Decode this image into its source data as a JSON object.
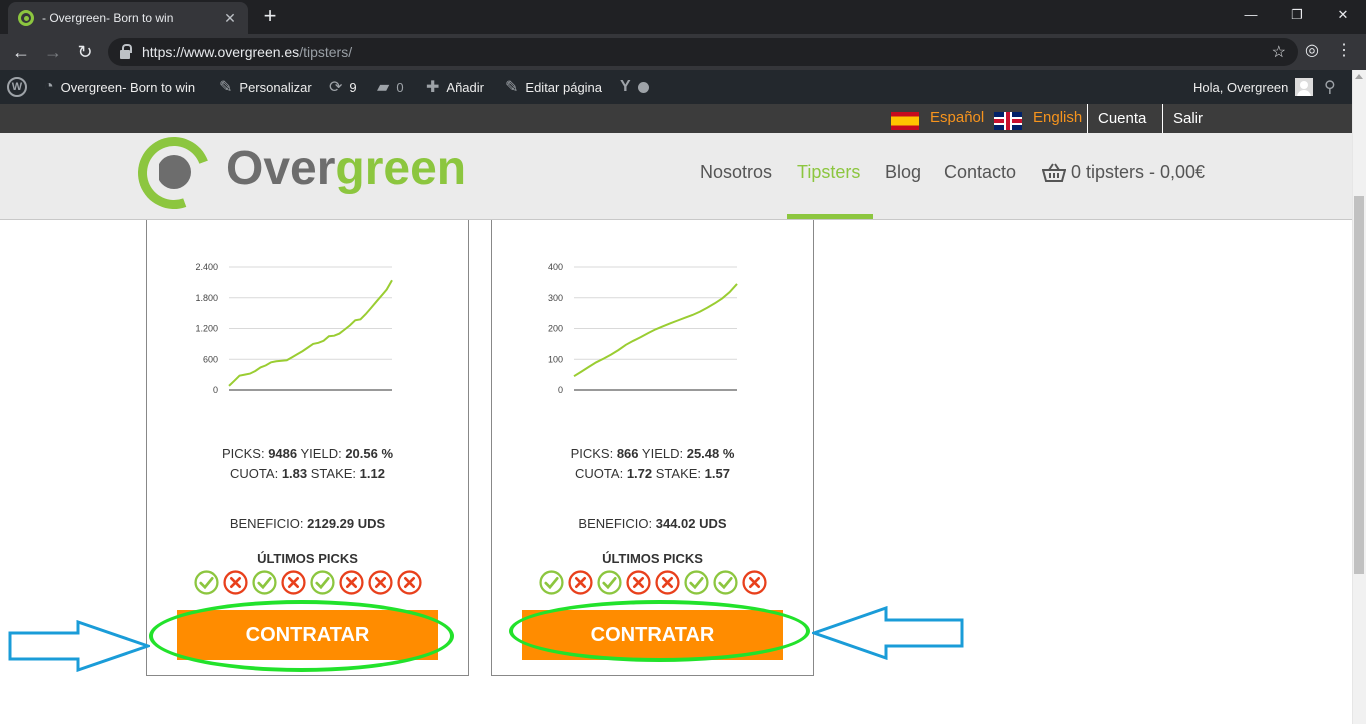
{
  "browser": {
    "tab_title": "- Overgreen- Born to win",
    "url_host": "https://www.overgreen.es",
    "url_path": "/tipsters/"
  },
  "adminbar": {
    "site_name": "Overgreen- Born to win",
    "customize": "Personalizar",
    "updates_count": "9",
    "comments_count": "0",
    "add_new": "Añadir",
    "edit_page": "Editar página",
    "greeting": "Hola, Overgreen"
  },
  "topbar": {
    "lang_es": "Español",
    "lang_en": "English",
    "account": "Cuenta",
    "logout": "Salir"
  },
  "header": {
    "logo_part1": "Over",
    "logo_part2": "green",
    "nav": [
      "Nosotros",
      "Tipsters",
      "Blog",
      "Contacto"
    ],
    "cart": "0 tipsters - 0,00€",
    "active_color": "#8cc63f"
  },
  "cards": [
    {
      "picks_label": "PICKS:",
      "picks": "9486",
      "yield_label": "YIELD:",
      "yield": "20.56 %",
      "cuota_label": "CUOTA:",
      "cuota": "1.83",
      "stake_label": "STAKE:",
      "stake": "1.12",
      "beneficio_label": "BENEFICIO:",
      "beneficio": "2129.29 UDS",
      "ultimos_label": "ÚLTIMOS PICKS",
      "last_picks": [
        "win",
        "loss",
        "win",
        "loss",
        "win",
        "loss",
        "loss",
        "loss"
      ],
      "button": "CONTRATAR"
    },
    {
      "picks_label": "PICKS:",
      "picks": "866",
      "yield_label": "YIELD:",
      "yield": "25.48 %",
      "cuota_label": "CUOTA:",
      "cuota": "1.72",
      "stake_label": "STAKE:",
      "stake": "1.57",
      "beneficio_label": "BENEFICIO:",
      "beneficio": "344.02 UDS",
      "ultimos_label": "ÚLTIMOS PICKS",
      "last_picks": [
        "win",
        "loss",
        "win",
        "loss",
        "loss",
        "win",
        "win",
        "loss"
      ],
      "button": "CONTRATAR"
    }
  ],
  "chart_data": [
    {
      "type": "line",
      "ylim": [
        0,
        2400
      ],
      "yticks": [
        0,
        600,
        1200,
        1800,
        2400
      ],
      "ytick_labels": [
        "0",
        "600",
        "1.200",
        "1.800",
        "2.400"
      ],
      "series": [
        {
          "values": [
            80,
            180,
            280,
            300,
            320,
            370,
            440,
            480,
            540,
            560,
            570,
            580,
            640,
            700,
            760,
            830,
            900,
            920,
            960,
            1050,
            1060,
            1100,
            1180,
            1260,
            1360,
            1380,
            1480,
            1600,
            1720,
            1840,
            1960,
            2140
          ]
        }
      ]
    },
    {
      "type": "line",
      "ylim": [
        0,
        400
      ],
      "yticks": [
        0,
        100,
        200,
        300,
        400
      ],
      "ytick_labels": [
        "0",
        "100",
        "200",
        "300",
        "400"
      ],
      "series": [
        {
          "values": [
            45,
            60,
            75,
            90,
            102,
            115,
            130,
            147,
            160,
            172,
            185,
            197,
            207,
            217,
            226,
            235,
            244,
            255,
            268,
            282,
            298,
            318,
            345
          ]
        }
      ]
    }
  ],
  "colors": {
    "line": "#9acd32",
    "win": "#8cc63f",
    "loss": "#e8401c",
    "button": "#ff8c00"
  }
}
